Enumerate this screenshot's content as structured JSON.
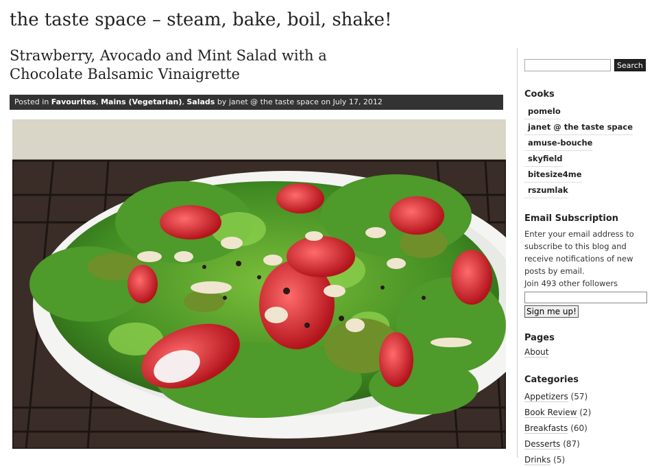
{
  "site": {
    "title": "the taste space – steam, bake, boil, shake!"
  },
  "post": {
    "title": "Strawberry, Avocado and Mint Salad with a Chocolate Balsamic Vinaigrette",
    "meta": {
      "posted_in": "Posted in",
      "cat1": "Favourites",
      "sep1": ", ",
      "cat2": "Mains (Vegetarian)",
      "sep2": ", ",
      "cat3": "Salads",
      "by": " by ",
      "author": "janet @ the taste space",
      "on": " on ",
      "date": "July 17, 2012"
    }
  },
  "sidebar": {
    "search": {
      "button": "Search",
      "value": ""
    },
    "cooks": {
      "title": "Cooks",
      "items": [
        "pomelo",
        "janet @ the taste space",
        "amuse-bouche",
        "skyfield",
        "bitesize4me",
        "rszumlak"
      ]
    },
    "email": {
      "title": "Email Subscription",
      "text": "Enter your email address to subscribe to this blog and receive notifications of new posts by email.",
      "followers": "Join 493 other followers",
      "button": "Sign me up!"
    },
    "pages": {
      "title": "Pages",
      "items": [
        "About"
      ]
    },
    "categories": {
      "title": "Categories",
      "items": [
        {
          "name": "Appetizers",
          "count": " (57)"
        },
        {
          "name": "Book Review",
          "count": " (2)"
        },
        {
          "name": "Breakfasts",
          "count": " (60)"
        },
        {
          "name": "Desserts",
          "count": " (87)"
        },
        {
          "name": "Drinks",
          "count": " (5)"
        }
      ]
    }
  }
}
